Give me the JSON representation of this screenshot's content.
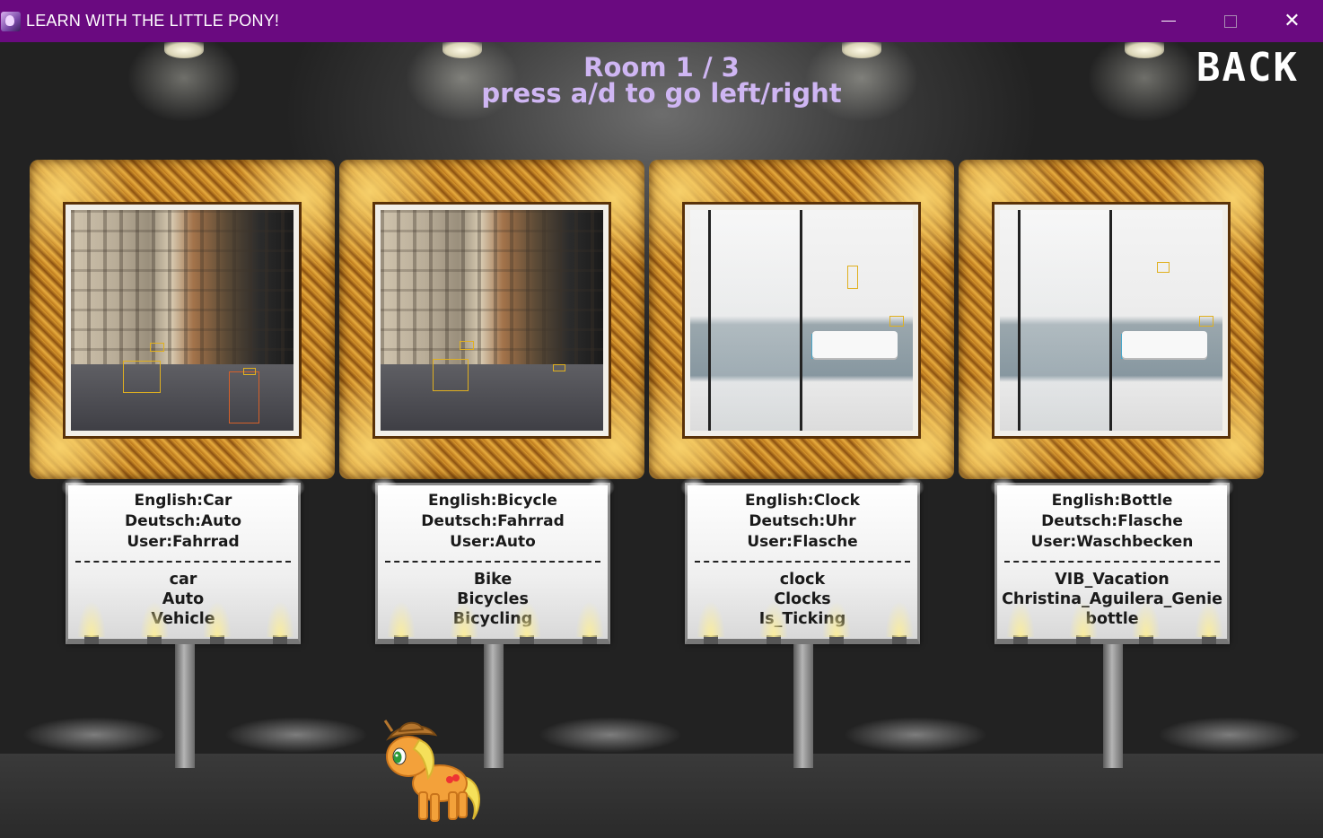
{
  "window": {
    "title": "LEARN WITH THE LITTLE PONY!",
    "minimize_icon": "minimize-icon",
    "maximize_icon": "maximize-icon",
    "close_icon": "close-icon",
    "close_glyph": "✕",
    "title_bar_color": "#6a0a80"
  },
  "hud": {
    "room": "Room 1 / 3",
    "hint": "press a/d to go left/right",
    "back_label": "BACK",
    "hud_color": "#cfb6f3"
  },
  "exhibits": [
    {
      "image": "street-photo",
      "english": "English:Car",
      "deutsch": "Deutsch:Auto",
      "user": "User:Fahrrad",
      "tags": [
        "car",
        "Auto",
        "Vehicle"
      ]
    },
    {
      "image": "street-photo",
      "english": "English:Bicycle",
      "deutsch": "Deutsch:Fahrrad",
      "user": "User:Auto",
      "tags": [
        "Bike",
        "Bicycles",
        "Bicycling"
      ]
    },
    {
      "image": "bathroom-photo",
      "english": "English:Clock",
      "deutsch": "Deutsch:Uhr",
      "user": "User:Flasche",
      "tags": [
        "clock",
        "Clocks",
        "Is_Ticking"
      ]
    },
    {
      "image": "bathroom-photo",
      "english": "English:Bottle",
      "deutsch": "Deutsch:Flasche",
      "user": "User:Waschbecken",
      "tags": [
        "VIB_Vacation",
        "Christina_Aguilera_Genie",
        "bottle"
      ]
    }
  ],
  "player": {
    "character": "pony-sprite"
  }
}
